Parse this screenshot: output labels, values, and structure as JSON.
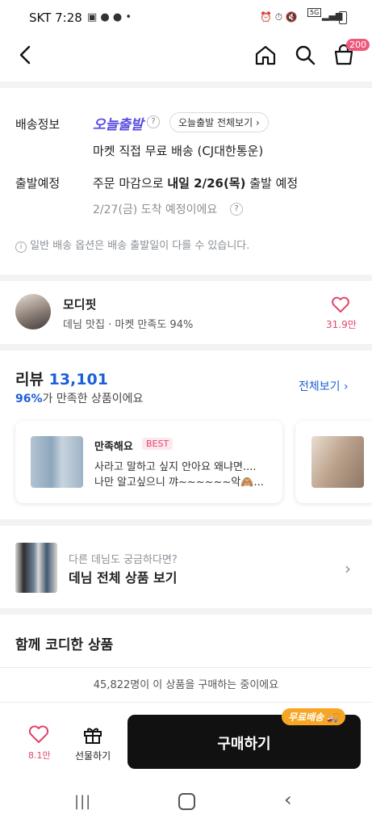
{
  "status_bar": {
    "carrier_time": "SKT 7:28",
    "network": "5G"
  },
  "header": {
    "cart_count": "200"
  },
  "delivery": {
    "label": "배송정보",
    "brand": "오늘출발",
    "view_all": "오늘출발 전체보기",
    "description": "마켓 직접 무료 배송 (CJ대한통운)",
    "departure_label": "출발예정",
    "departure_prefix": "주문 마감으로 ",
    "departure_bold": "내일 2/26(목)",
    "departure_suffix": " 출발 예정",
    "arrival": "2/27(금) 도착 예정이에요",
    "notice": "일반 배송 옵션은 배송 출발일이 다를 수 있습니다."
  },
  "shop": {
    "name": "모디핏",
    "desc": "데님 맛집 · 마켓 만족도 94%",
    "likes": "31.9만"
  },
  "reviews": {
    "title": "리뷰",
    "count": "13,101",
    "satisfaction_pct": "96%",
    "satisfaction_text": "가 만족한 상품이에요",
    "view_all": "전체보기",
    "items": [
      {
        "rating_label": "만족해요",
        "badge": "BEST",
        "line1": "사라고 말하고 싶지 안아요 왜냐면....",
        "line2": "나만 알고싶으니 꺄~~~~~~악🙈..."
      }
    ]
  },
  "promo": {
    "subtitle": "다른 데님도 궁금하다면?",
    "title": "데님 전체 상품 보기"
  },
  "coordi": {
    "title": "함께 코디한 상품"
  },
  "purchase_notice": "45,822명이 이 상품을 구매하는 중이에요",
  "bottom_bar": {
    "like_count": "8.1만",
    "gift_label": "선물하기",
    "buy_label": "구매하기",
    "free_shipping": "무료배송"
  },
  "colors": {
    "accent_blue": "#1e5fd8",
    "brand_purple": "#5a4de0",
    "pink": "#e2456b",
    "orange": "#f6a623"
  }
}
